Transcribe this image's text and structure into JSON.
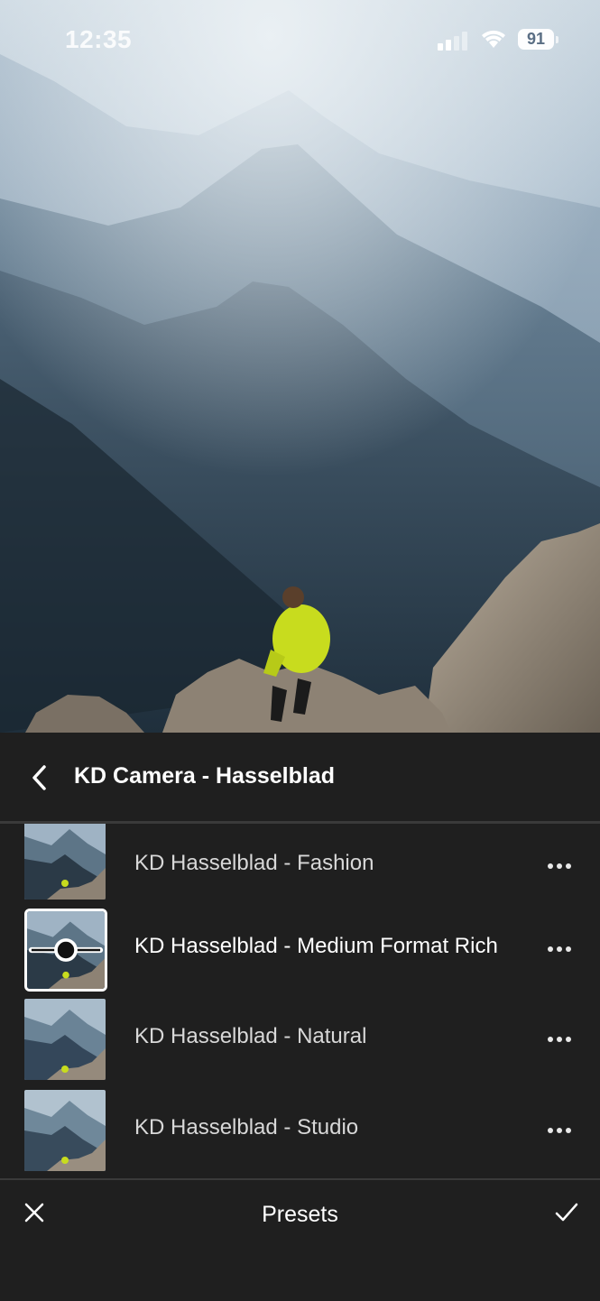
{
  "status_bar": {
    "time": "12:35",
    "battery": "91"
  },
  "header": {
    "title": "KD Camera - Hasselblad",
    "back_icon": "chevron-left-icon"
  },
  "presets": [
    {
      "label": "KD Hasselblad - Fashion",
      "selected": false
    },
    {
      "label": "KD Hasselblad - Medium Format Rich",
      "selected": true
    },
    {
      "label": "KD Hasselblad - Natural",
      "selected": false
    },
    {
      "label": "KD Hasselblad - Studio",
      "selected": false
    }
  ],
  "bottom_bar": {
    "title": "Presets",
    "close_icon": "close-icon",
    "confirm_icon": "checkmark-icon"
  },
  "colors": {
    "panel_bg": "#1f1f1f",
    "divider": "#3a3a3a",
    "jacket": "#c8dc1e"
  }
}
